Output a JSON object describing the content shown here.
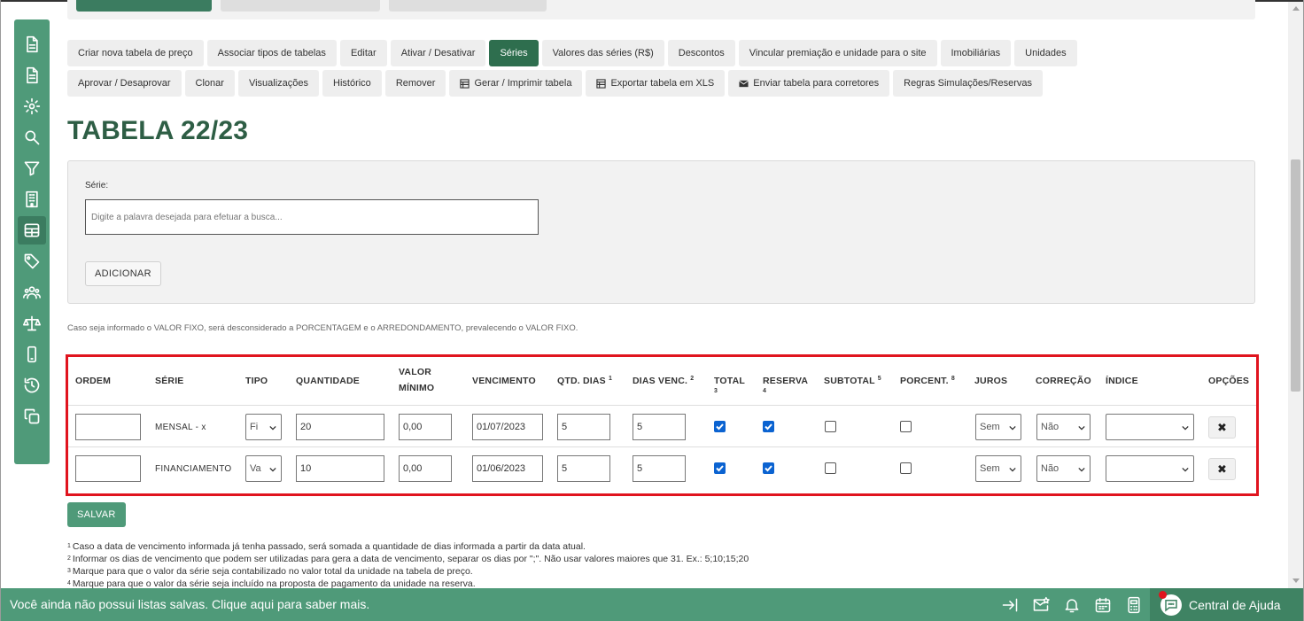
{
  "toolbar": {
    "row1": [
      {
        "label": "Criar nova tabela de preço",
        "name": "create-price-table-button"
      },
      {
        "label": "Associar tipos de tabelas",
        "name": "associate-table-types-button"
      },
      {
        "label": "Editar",
        "name": "edit-button"
      },
      {
        "label": "Ativar / Desativar",
        "name": "activate-deactivate-button"
      },
      {
        "label": "Séries",
        "name": "series-button"
      },
      {
        "label": "Valores das séries (R$)",
        "name": "series-values-button"
      },
      {
        "label": "Descontos",
        "name": "discounts-button"
      },
      {
        "label": "Vincular premiação e unidade para o site",
        "name": "link-award-unit-button"
      },
      {
        "label": "Imobiliárias",
        "name": "real-estate-agencies-button"
      },
      {
        "label": "Unidades",
        "name": "units-button"
      }
    ],
    "row2": [
      {
        "label": "Aprovar / Desaprovar",
        "name": "approve-disapprove-button"
      },
      {
        "label": "Clonar",
        "name": "clone-button"
      },
      {
        "label": "Visualizações",
        "name": "views-button"
      },
      {
        "label": "Histórico",
        "name": "history-button"
      },
      {
        "label": "Remover",
        "name": "remove-button"
      },
      {
        "label": "Gerar / Imprimir tabela",
        "name": "print-table-button",
        "icon": "table-icon"
      },
      {
        "label": "Exportar tabela em XLS",
        "name": "export-xls-button",
        "icon": "table-icon"
      },
      {
        "label": "Enviar tabela para corretores",
        "name": "send-to-brokers-button",
        "icon": "envelope-icon"
      },
      {
        "label": "Regras Simulações/Reservas",
        "name": "simulation-rules-button"
      }
    ],
    "active": "Séries"
  },
  "page": {
    "title": "TABELA 22/23"
  },
  "filter": {
    "label": "Série:",
    "placeholder": "Digite a palavra desejada para efetuar a busca...",
    "add_label": "ADICIONAR"
  },
  "notice": "Caso seja informado o VALOR FIXO, será desconsiderado a PORCENTAGEM e o ARREDONDAMENTO, prevalecendo o VALOR FIXO.",
  "table": {
    "headers": {
      "ordem": "ORDEM",
      "serie": "SÉRIE",
      "tipo": "TIPO",
      "quantidade": "QUANTIDADE",
      "valor_minimo_1": "VALOR",
      "valor_minimo_2": "MÍNIMO",
      "vencimento": "VENCIMENTO",
      "qtd_dias": "QTD. DIAS",
      "qtd_dias_sup": "1",
      "dias_venc": "DIAS VENC.",
      "dias_venc_sup": "2",
      "total": "TOTAL",
      "total_sup": "3",
      "reserva": "RESERVA",
      "reserva_sup": "4",
      "subtotal": "SUBTOTAL",
      "subtotal_sup": "5",
      "porcent": "PORCENT.",
      "porcent_sup": "8",
      "juros": "JUROS",
      "correcao": "CORREÇÃO",
      "indice": "ÍNDICE",
      "opcoes": "OPÇÕES"
    },
    "rows": [
      {
        "ordem": "",
        "serie": "MENSAL - x",
        "tipo": "Fi",
        "quantidade": "20",
        "valor_minimo": "0,00",
        "vencimento": "01/07/2023",
        "qtd_dias": "5",
        "dias_venc": "5",
        "total": true,
        "reserva": true,
        "subtotal": false,
        "porcent": false,
        "juros": "Sem",
        "correcao": "Não",
        "indice": ""
      },
      {
        "ordem": "",
        "serie": "FINANCIAMENTO",
        "tipo": "Va",
        "quantidade": "10",
        "valor_minimo": "0,00",
        "vencimento": "01/06/2023",
        "qtd_dias": "5",
        "dias_venc": "5",
        "total": true,
        "reserva": true,
        "subtotal": false,
        "porcent": false,
        "juros": "Sem",
        "correcao": "Não",
        "indice": ""
      }
    ],
    "remove_glyph": "✖"
  },
  "save_label": "SALVAR",
  "footnotes": [
    {
      "n": "1",
      "text": "Caso a data de vencimento informada já tenha passado, será somada a quantidade de dias informada a partir da data atual."
    },
    {
      "n": "2",
      "text": "Informar os dias de vencimento que podem ser utilizadas para gera a data de vencimento, separar os dias por \";\". Não usar valores maiores que 31. Ex.: 5;10;15;20"
    },
    {
      "n": "3",
      "text": "Marque para que o valor da série seja contabilizado no valor total da unidade na tabela de preço."
    },
    {
      "n": "4",
      "text": "Marque para que o valor da série seja incluído na proposta de pagamento da unidade na reserva."
    }
  ],
  "bottom": {
    "message": "Você ainda não possui listas salvas. Clique aqui para saber mais.",
    "help_label": "Central de Ajuda"
  },
  "colors": {
    "primary": "#4f9a79",
    "active": "#2e6e4e",
    "title": "#2e5e45",
    "highlight": "#e0141e",
    "checkbox": "#0b63d1"
  }
}
